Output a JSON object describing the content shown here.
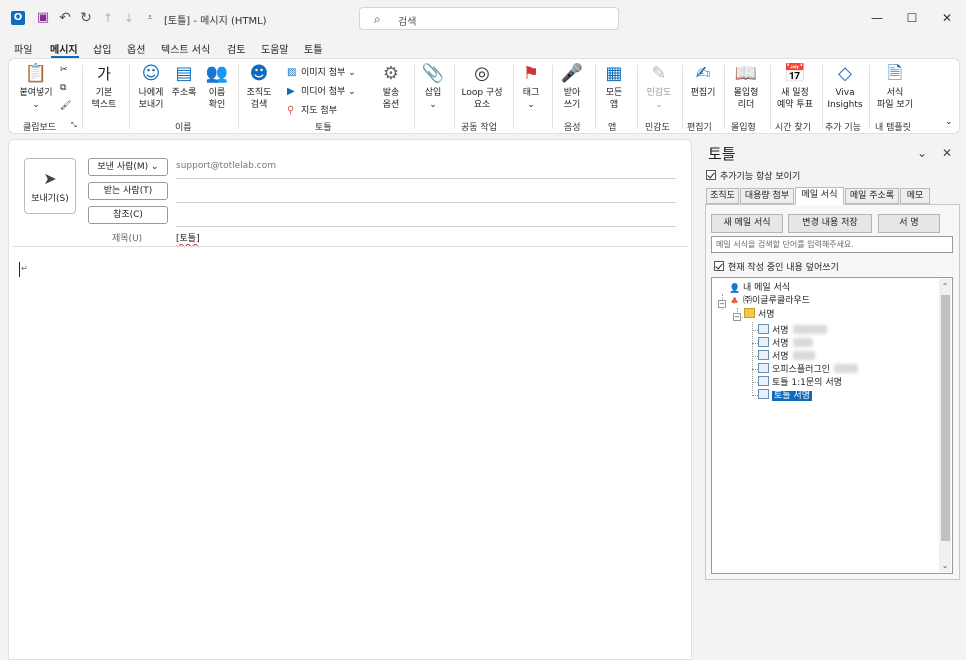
{
  "window": {
    "title": "[토틀]  -  메시지 (HTML)",
    "search_placeholder": "검색",
    "minimize": "—",
    "maximize": "☐",
    "close": "✕"
  },
  "menu": {
    "tabs": [
      "파일",
      "메시지",
      "삽입",
      "옵션",
      "텍스트 서식",
      "검토",
      "도움말",
      "토틀"
    ],
    "active": "메시지"
  },
  "ribbon": {
    "paste": "붙여넣기",
    "basic_text_line1": "기본",
    "basic_text_line2": "텍스트",
    "to_me_line1": "나에게",
    "to_me_line2": "보내기",
    "address_book": "주소록",
    "check_names_line1": "이름",
    "check_names_line2": "확인",
    "org_search_line1": "조직도",
    "org_search_line2": "검색",
    "attach_image": "이미지 첨부",
    "attach_media": "미디어 첨부",
    "attach_map": "지도 첨부",
    "send_options_line1": "발송",
    "send_options_line2": "옵션",
    "insert": "삽입",
    "loop_line1": "Loop 구성",
    "loop_line2": "요소",
    "tags": "태그",
    "dictate_line1": "받아",
    "dictate_line2": "쓰기",
    "all_apps_line1": "모든",
    "all_apps_line2": "앱",
    "sensitivity": "민감도",
    "editor": "편집기",
    "immersive_line1": "몰입형",
    "immersive_line2": "리더",
    "new_poll_line1": "새 일정",
    "new_poll_line2": "예약 투표",
    "viva_line1": "Viva",
    "viva_line2": "Insights",
    "templates_line1": "서식",
    "templates_line2": "파일 보기",
    "groups": {
      "clipboard": "클립보드",
      "names": "이름",
      "totle": "토틀",
      "collab": "공동 작업",
      "voice": "음성",
      "apps": "앱",
      "sensitivity": "민감도",
      "editor": "편집기",
      "immersive": "몰입형",
      "find_time": "시간 찾기",
      "addins": "추가 기능",
      "my_templates": "내 템플릿"
    }
  },
  "compose": {
    "send": "보내기(S)",
    "from_button": "보낸 사람(M)",
    "from_value": "support@totlelab.com",
    "to_button": "받는 사람(T)",
    "cc_button": "참조(C)",
    "subject_label": "제목(U)",
    "subject_value": "[토틀]",
    "para_mark": "↵"
  },
  "pane": {
    "title": "토틀",
    "always_show": "추가기능 항상 보이기",
    "tabs": [
      "조직도",
      "대용량 첨부",
      "메일 서식",
      "메일 주소록",
      "메모"
    ],
    "active_tab": "메일 서식",
    "new_template": "새 메일 서식",
    "save_changes": "변경 내용 저장",
    "signature": "서 명",
    "search_placeholder": "메일 서식을 검색할 단어를 입력해주세요.",
    "overwrite": "현재 작성 중인 내용 덮어쓰기",
    "tree": {
      "my_templates": "내 메일 서식",
      "company": "㈜이글루클라우드",
      "signature_folder": "서명",
      "items": [
        "서명",
        "서명",
        "서명",
        "오피스플러그인",
        "토틀 1:1문의 서명",
        "토틀 서명"
      ]
    }
  }
}
